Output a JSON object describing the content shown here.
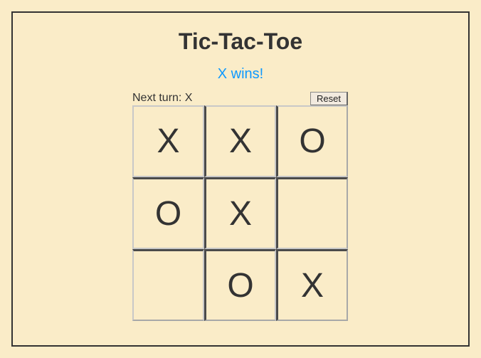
{
  "game": {
    "title": "Tic-Tac-Toe",
    "status": "X wins!",
    "next_turn": "Next turn: X",
    "reset_label": "Reset",
    "board": [
      [
        "X",
        "X",
        "O"
      ],
      [
        "O",
        "X",
        ""
      ],
      [
        "",
        "O",
        "X"
      ]
    ]
  },
  "colors": {
    "background": "#faecc8",
    "status_text": "#0d99ff",
    "text": "#333333"
  }
}
